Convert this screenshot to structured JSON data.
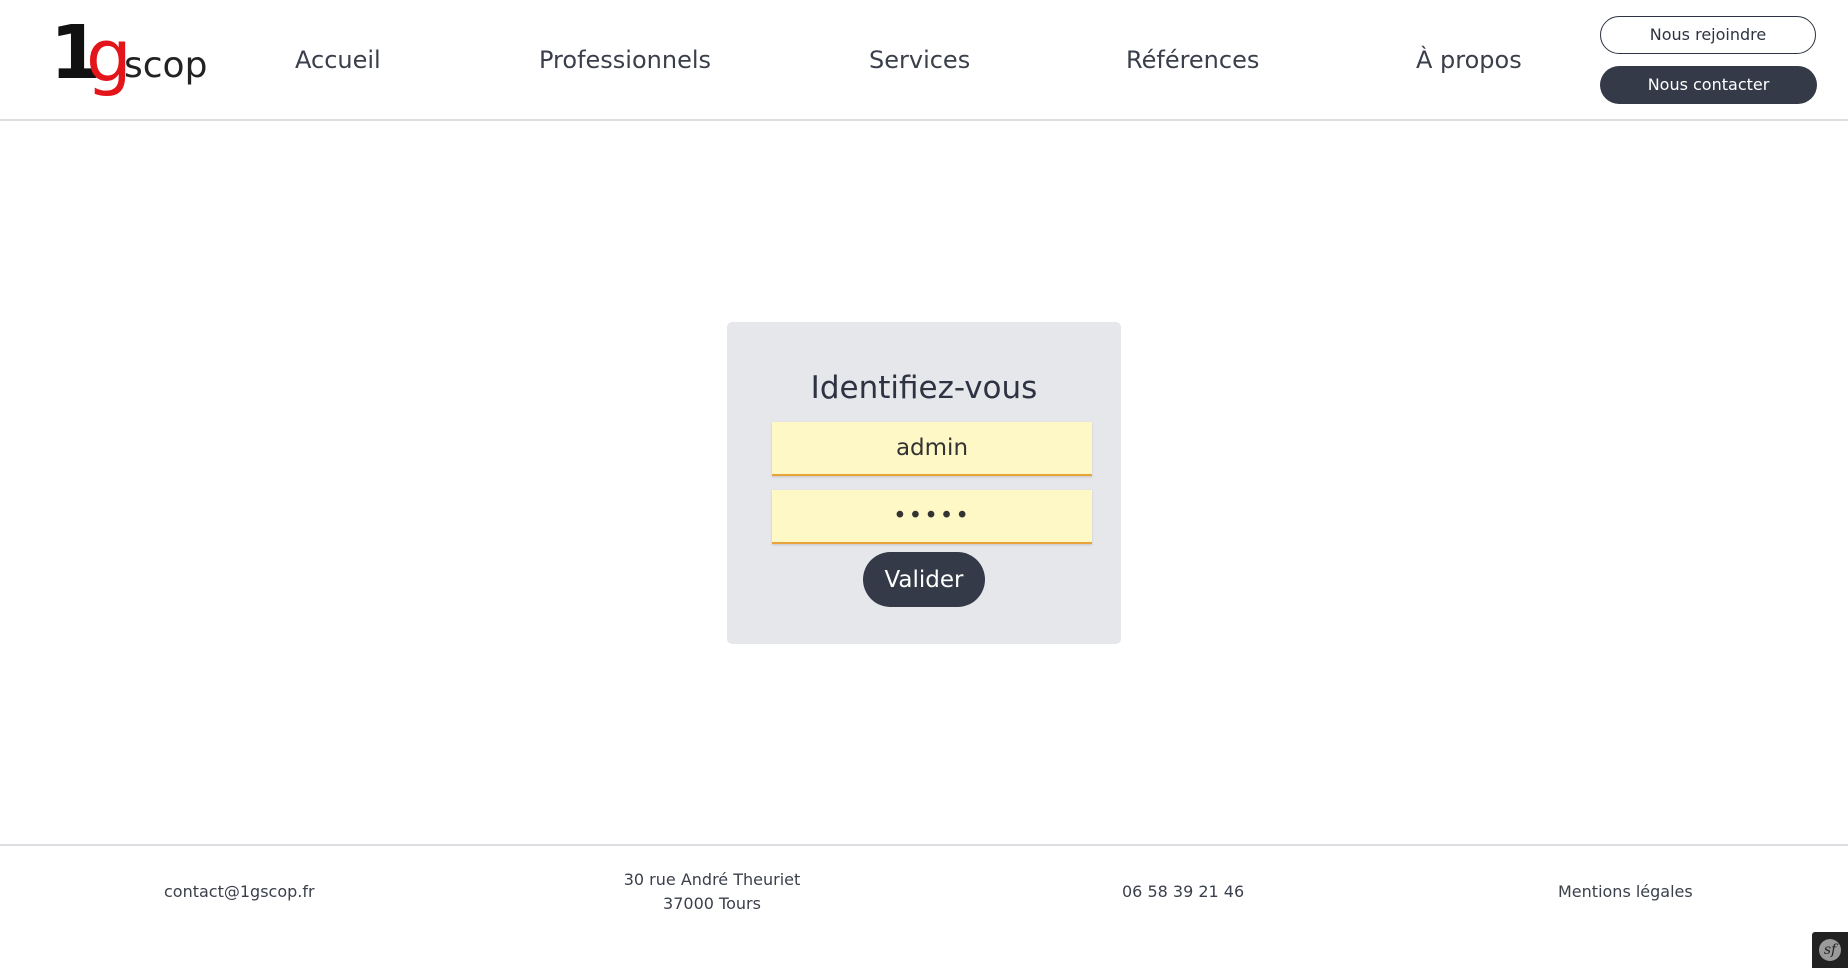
{
  "header": {
    "logo": {
      "one": "1",
      "g": "g",
      "scop": "scop"
    },
    "nav": [
      "Accueil",
      "Professionnels",
      "Services",
      "Références",
      "À propos"
    ],
    "join_label": "Nous rejoindre",
    "contact_label": "Nous contacter"
  },
  "login": {
    "title": "Identifiez-vous",
    "username_value": "admin",
    "password_value": "•••••",
    "submit_label": "Valider"
  },
  "footer": {
    "email": "contact@1gscop.fr",
    "address_line1": "30 rue André Theuriet",
    "address_line2": "37000 Tours",
    "phone": "06 58 39 21 46",
    "legal": "Mentions légales"
  },
  "debug_toolbar": {
    "icon": "symfony-icon",
    "glyph": "sf"
  },
  "colors": {
    "dark": "#343a48",
    "accent_red": "#e3151a",
    "field_bg": "#fdf8c6",
    "field_border": "#e8a33b",
    "card_bg": "#e6e7ea"
  }
}
